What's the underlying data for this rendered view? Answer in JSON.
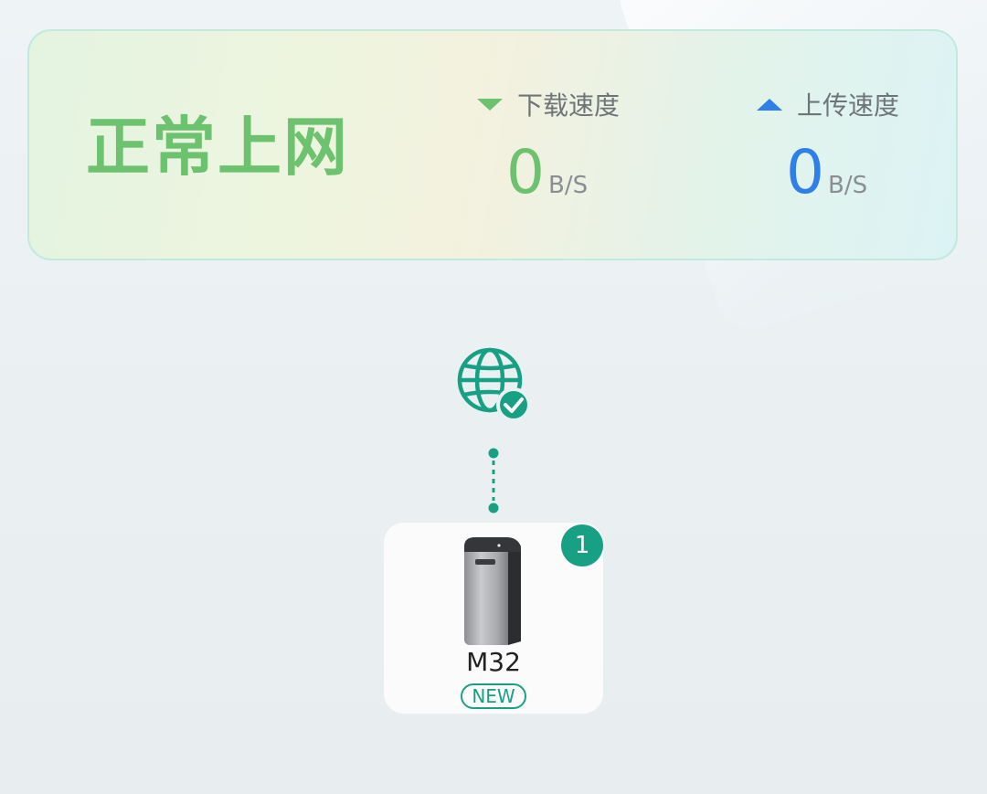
{
  "status": {
    "title": "正常上网",
    "download": {
      "label": "下载速度",
      "value": "0",
      "unit": "B/S",
      "icon": "triangle-down-icon",
      "color": "#6cc26e"
    },
    "upload": {
      "label": "上传速度",
      "value": "0",
      "unit": "B/S",
      "icon": "triangle-up-icon",
      "color": "#2f7fe9"
    }
  },
  "topology": {
    "internet_icon": "globe-check-icon",
    "accent_color": "#18a085",
    "device": {
      "name": "M32",
      "badge": "NEW",
      "count": "1",
      "image": "mesh-router-image"
    }
  }
}
